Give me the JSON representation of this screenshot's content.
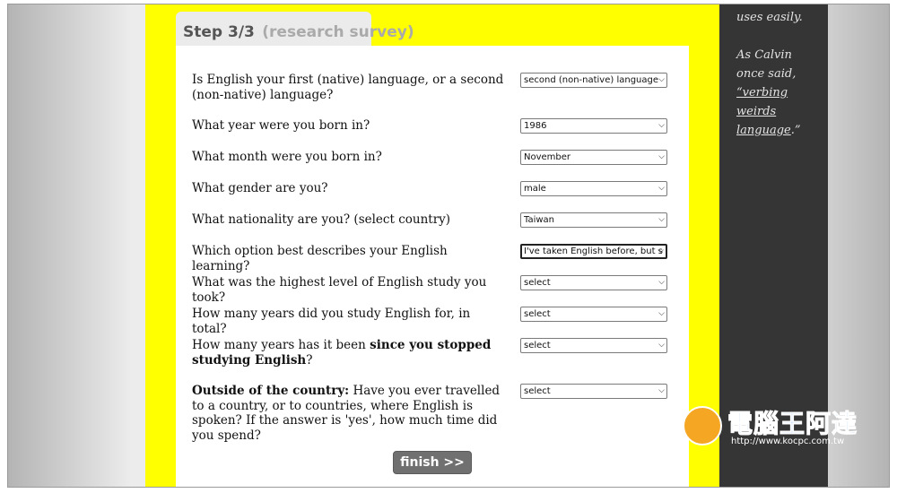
{
  "step_tab": {
    "step": "Step 3/3",
    "subtitle": "(research survey)"
  },
  "sidebar": {
    "line1": "uses easily.",
    "line2": "As Calvin",
    "line3": "once said,",
    "quote1": "“verbing",
    "quote2": "weirds",
    "quote3": "language",
    "quote3_tail": ".”"
  },
  "questions": [
    {
      "label": "Is English your first (native) language, or a second (non-native) language?",
      "value": "second (non-native) language"
    },
    {
      "label": "What year were you born in?",
      "value": "1986"
    },
    {
      "label": "What month were you born in?",
      "value": "November"
    },
    {
      "label": "What gender are you?",
      "value": "male"
    },
    {
      "label": "What nationality are you? (select country)",
      "value": "Taiwan"
    },
    {
      "label": "Which option best describes your English learning?",
      "value": "I've taken English before, but s"
    },
    {
      "label": "What was the highest level of English study you took?",
      "value": "select"
    },
    {
      "label": "How many years did you study English for, in total?",
      "value": "select"
    },
    {
      "label_pre": "How many years has it been ",
      "label_bold": "since you stopped studying English",
      "label_post": "?",
      "value": "select"
    },
    {
      "label_bold": "Outside of the country:",
      "label_post": " Have you ever travelled to a country, or to countries, where English is spoken? If the answer is 'yes', how much time did you spend?",
      "value": "select"
    }
  ],
  "finish_label": "finish >>",
  "watermark": {
    "text": "電腦王阿達",
    "url": "http://www.kocpc.com.tw"
  },
  "colors": {
    "accent_yellow": "#ffff00",
    "sidebar_bg": "#353535",
    "button_bg": "#707070"
  }
}
